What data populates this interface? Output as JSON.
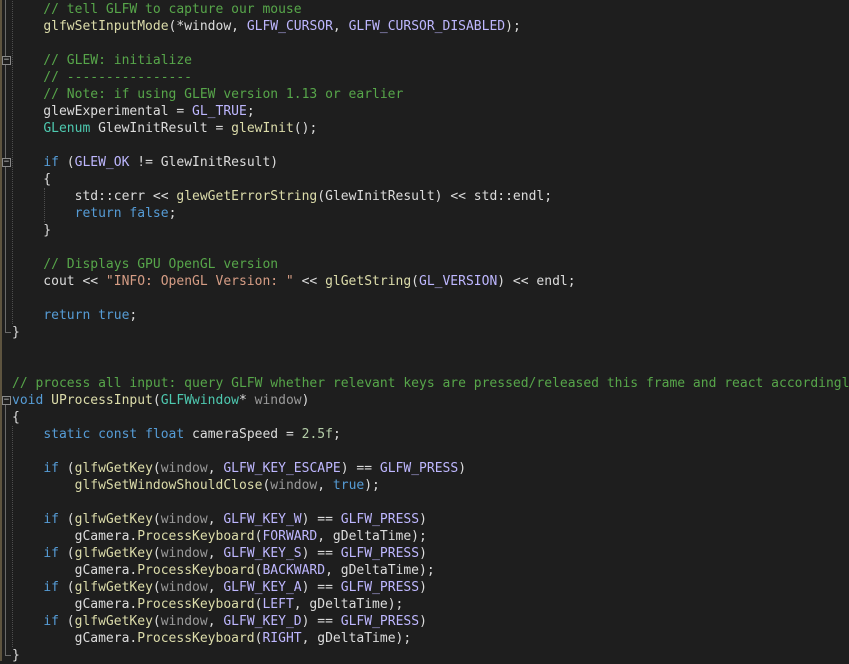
{
  "editor": {
    "theme": {
      "background": "#1e1e1e",
      "comment": "#57a64a",
      "keyword": "#569cd6",
      "function": "#dcdcaa",
      "type": "#4ec9b0",
      "macro": "#beb7ff",
      "string": "#d69d85",
      "number": "#b5cea8",
      "parameter": "#9a9a9a",
      "text": "#dcdcdc"
    },
    "fold_icons": [
      "collapse-icon",
      "collapse-icon",
      "collapse-icon"
    ],
    "lines": [
      [
        [
          "comment",
          "    // tell GLFW to capture our mouse"
        ]
      ],
      [
        [
          "plain",
          "    "
        ],
        [
          "fn",
          "glfwSetInputMode"
        ],
        [
          "plain",
          "(*window, "
        ],
        [
          "macro",
          "GLFW_CURSOR"
        ],
        [
          "plain",
          ", "
        ],
        [
          "macro",
          "GLFW_CURSOR_DISABLED"
        ],
        [
          "plain",
          ");"
        ]
      ],
      [],
      [
        [
          "comment",
          "    // GLEW: initialize"
        ]
      ],
      [
        [
          "comment",
          "    // ----------------"
        ]
      ],
      [
        [
          "comment",
          "    // Note: if using GLEW version 1.13 or earlier"
        ]
      ],
      [
        [
          "plain",
          "    glewExperimental = "
        ],
        [
          "macro",
          "GL_TRUE"
        ],
        [
          "plain",
          ";"
        ]
      ],
      [
        [
          "plain",
          "    "
        ],
        [
          "type",
          "GLenum"
        ],
        [
          "plain",
          " GlewInitResult = "
        ],
        [
          "fn",
          "glewInit"
        ],
        [
          "plain",
          "();"
        ]
      ],
      [],
      [
        [
          "plain",
          "    "
        ],
        [
          "kw",
          "if"
        ],
        [
          "plain",
          " ("
        ],
        [
          "macro",
          "GLEW_OK"
        ],
        [
          "plain",
          " != GlewInitResult)"
        ]
      ],
      [
        [
          "plain",
          "    {"
        ]
      ],
      [
        [
          "plain",
          "        std::cerr << "
        ],
        [
          "fn",
          "glewGetErrorString"
        ],
        [
          "plain",
          "(GlewInitResult) << std::endl;"
        ]
      ],
      [
        [
          "plain",
          "        "
        ],
        [
          "kw",
          "return"
        ],
        [
          "plain",
          " "
        ],
        [
          "kw",
          "false"
        ],
        [
          "plain",
          ";"
        ]
      ],
      [
        [
          "plain",
          "    }"
        ]
      ],
      [],
      [
        [
          "comment",
          "    // Displays GPU OpenGL version"
        ]
      ],
      [
        [
          "plain",
          "    cout << "
        ],
        [
          "str",
          "\"INFO: OpenGL Version: \""
        ],
        [
          "plain",
          " << "
        ],
        [
          "fn",
          "glGetString"
        ],
        [
          "plain",
          "("
        ],
        [
          "macro",
          "GL_VERSION"
        ],
        [
          "plain",
          ") << endl;"
        ]
      ],
      [],
      [
        [
          "plain",
          "    "
        ],
        [
          "kw",
          "return"
        ],
        [
          "plain",
          " "
        ],
        [
          "kw",
          "true"
        ],
        [
          "plain",
          ";"
        ]
      ],
      [
        [
          "plain",
          "}"
        ]
      ],
      [],
      [],
      [
        [
          "comment",
          "// process all input: query GLFW whether relevant keys are pressed/released this frame and react accordingly"
        ]
      ],
      [
        [
          "kw",
          "void"
        ],
        [
          "plain",
          " "
        ],
        [
          "fn",
          "UProcessInput"
        ],
        [
          "plain",
          "("
        ],
        [
          "type",
          "GLFWwindow"
        ],
        [
          "plain",
          "* "
        ],
        [
          "param",
          "window"
        ],
        [
          "plain",
          ")"
        ]
      ],
      [
        [
          "plain",
          "{"
        ]
      ],
      [
        [
          "plain",
          "    "
        ],
        [
          "kw",
          "static"
        ],
        [
          "plain",
          " "
        ],
        [
          "kw",
          "const"
        ],
        [
          "plain",
          " "
        ],
        [
          "kw",
          "float"
        ],
        [
          "plain",
          " cameraSpeed = "
        ],
        [
          "num",
          "2.5f"
        ],
        [
          "plain",
          ";"
        ]
      ],
      [],
      [
        [
          "plain",
          "    "
        ],
        [
          "kw",
          "if"
        ],
        [
          "plain",
          " ("
        ],
        [
          "fn",
          "glfwGetKey"
        ],
        [
          "plain",
          "("
        ],
        [
          "param",
          "window"
        ],
        [
          "plain",
          ", "
        ],
        [
          "macro",
          "GLFW_KEY_ESCAPE"
        ],
        [
          "plain",
          ") == "
        ],
        [
          "macro",
          "GLFW_PRESS"
        ],
        [
          "plain",
          ")"
        ]
      ],
      [
        [
          "plain",
          "        "
        ],
        [
          "fn",
          "glfwSetWindowShouldClose"
        ],
        [
          "plain",
          "("
        ],
        [
          "param",
          "window"
        ],
        [
          "plain",
          ", "
        ],
        [
          "kw",
          "true"
        ],
        [
          "plain",
          ");"
        ]
      ],
      [],
      [
        [
          "plain",
          "    "
        ],
        [
          "kw",
          "if"
        ],
        [
          "plain",
          " ("
        ],
        [
          "fn",
          "glfwGetKey"
        ],
        [
          "plain",
          "("
        ],
        [
          "param",
          "window"
        ],
        [
          "plain",
          ", "
        ],
        [
          "macro",
          "GLFW_KEY_W"
        ],
        [
          "plain",
          ") == "
        ],
        [
          "macro",
          "GLFW_PRESS"
        ],
        [
          "plain",
          ")"
        ]
      ],
      [
        [
          "plain",
          "        gCamera."
        ],
        [
          "fn",
          "ProcessKeyboard"
        ],
        [
          "plain",
          "("
        ],
        [
          "macro",
          "FORWARD"
        ],
        [
          "plain",
          ", gDeltaTime);"
        ]
      ],
      [
        [
          "plain",
          "    "
        ],
        [
          "kw",
          "if"
        ],
        [
          "plain",
          " ("
        ],
        [
          "fn",
          "glfwGetKey"
        ],
        [
          "plain",
          "("
        ],
        [
          "param",
          "window"
        ],
        [
          "plain",
          ", "
        ],
        [
          "macro",
          "GLFW_KEY_S"
        ],
        [
          "plain",
          ") == "
        ],
        [
          "macro",
          "GLFW_PRESS"
        ],
        [
          "plain",
          ")"
        ]
      ],
      [
        [
          "plain",
          "        gCamera."
        ],
        [
          "fn",
          "ProcessKeyboard"
        ],
        [
          "plain",
          "("
        ],
        [
          "macro",
          "BACKWARD"
        ],
        [
          "plain",
          ", gDeltaTime);"
        ]
      ],
      [
        [
          "plain",
          "    "
        ],
        [
          "kw",
          "if"
        ],
        [
          "plain",
          " ("
        ],
        [
          "fn",
          "glfwGetKey"
        ],
        [
          "plain",
          "("
        ],
        [
          "param",
          "window"
        ],
        [
          "plain",
          ", "
        ],
        [
          "macro",
          "GLFW_KEY_A"
        ],
        [
          "plain",
          ") == "
        ],
        [
          "macro",
          "GLFW_PRESS"
        ],
        [
          "plain",
          ")"
        ]
      ],
      [
        [
          "plain",
          "        gCamera."
        ],
        [
          "fn",
          "ProcessKeyboard"
        ],
        [
          "plain",
          "("
        ],
        [
          "macro",
          "LEFT"
        ],
        [
          "plain",
          ", gDeltaTime);"
        ]
      ],
      [
        [
          "plain",
          "    "
        ],
        [
          "kw",
          "if"
        ],
        [
          "plain",
          " ("
        ],
        [
          "fn",
          "glfwGetKey"
        ],
        [
          "plain",
          "("
        ],
        [
          "param",
          "window"
        ],
        [
          "plain",
          ", "
        ],
        [
          "macro",
          "GLFW_KEY_D"
        ],
        [
          "plain",
          ") == "
        ],
        [
          "macro",
          "GLFW_PRESS"
        ],
        [
          "plain",
          ")"
        ]
      ],
      [
        [
          "plain",
          "        gCamera."
        ],
        [
          "fn",
          "ProcessKeyboard"
        ],
        [
          "plain",
          "("
        ],
        [
          "macro",
          "RIGHT"
        ],
        [
          "plain",
          ", gDeltaTime);"
        ]
      ],
      [
        [
          "plain",
          "}"
        ]
      ]
    ]
  }
}
